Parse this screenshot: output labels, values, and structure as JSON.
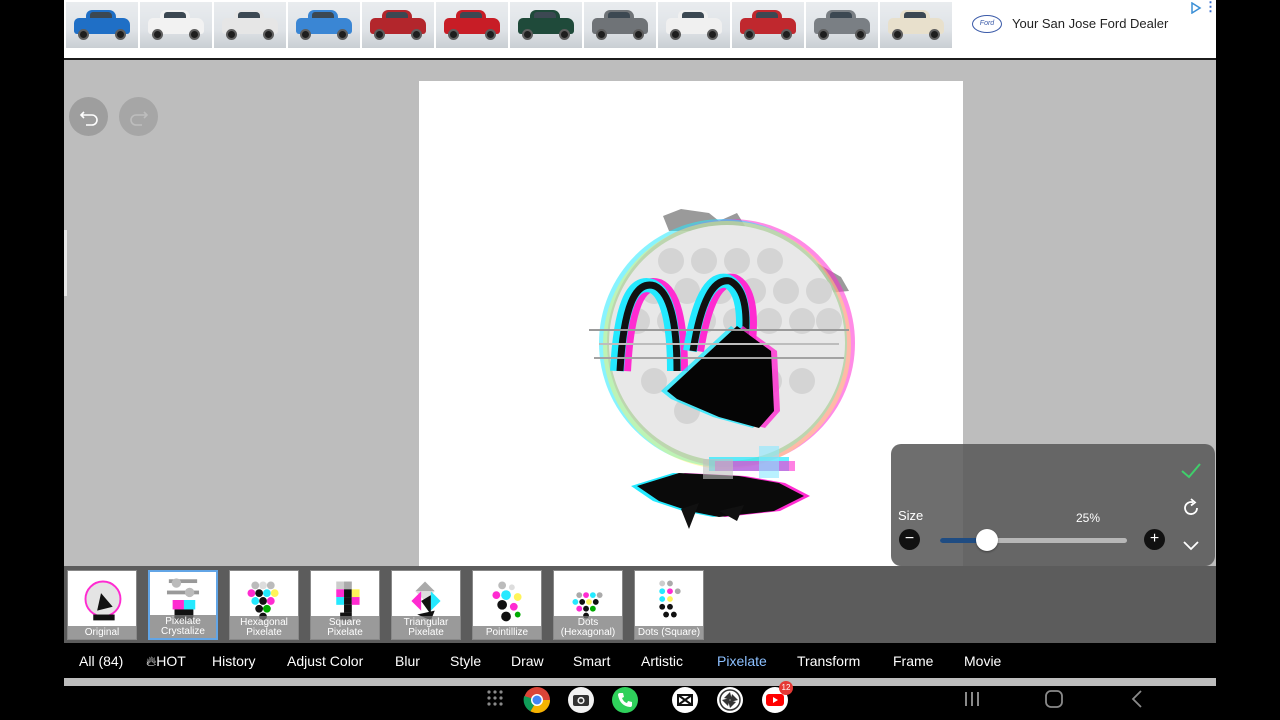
{
  "ad": {
    "text": "Your San Jose Ford Dealer",
    "logo_text": "Ford",
    "car_colors": [
      "#1f6fc6",
      "#f2f2f2",
      "#e6e6e6",
      "#3a86d4",
      "#b3262c",
      "#c81d26",
      "#1f4a3a",
      "#6f7377",
      "#f0f0f0",
      "#c0282e",
      "#7a7f84",
      "#e8e0cc"
    ]
  },
  "toolbar": {
    "undo_icon": "undo-icon",
    "redo_icon": "redo-icon"
  },
  "size_panel": {
    "label": "Size",
    "value_text": "25%",
    "value": 0.25,
    "minus": "−",
    "plus": "+"
  },
  "effects": [
    {
      "label": "Original",
      "selected": false
    },
    {
      "label": "Pixelate Crystalize",
      "selected": true
    },
    {
      "label": "Hexagonal Pixelate",
      "selected": false
    },
    {
      "label": "Square Pixelate",
      "selected": false
    },
    {
      "label": "Triangular Pixelate",
      "selected": false
    },
    {
      "label": "Pointillize",
      "selected": false
    },
    {
      "label": "Dots (Hexagonal)",
      "selected": false
    },
    {
      "label": "Dots (Square)",
      "selected": false
    }
  ],
  "categories": [
    {
      "label": "All (84)",
      "active": false
    },
    {
      "label": "HOT",
      "active": false
    },
    {
      "label": "History",
      "active": false
    },
    {
      "label": "Adjust Color",
      "active": false
    },
    {
      "label": "Blur",
      "active": false
    },
    {
      "label": "Style",
      "active": false
    },
    {
      "label": "Draw",
      "active": false
    },
    {
      "label": "Smart",
      "active": false
    },
    {
      "label": "Artistic",
      "active": false
    },
    {
      "label": "Pixelate",
      "active": true
    },
    {
      "label": "Transform",
      "active": false
    },
    {
      "label": "Frame",
      "active": false
    },
    {
      "label": "Movie",
      "active": false
    }
  ],
  "dock": {
    "badge": "12",
    "apps": [
      "app-drawer-icon",
      "chrome-icon",
      "camera-icon",
      "phone-icon",
      "capcut-icon",
      "pinwheel-app-icon",
      "youtube-icon"
    ]
  },
  "colors": {
    "accent": "#8cc0ff",
    "selected_border": "#62a5e6",
    "slider_fill": "#1f4c82",
    "apply_check": "#3fcf6b"
  }
}
